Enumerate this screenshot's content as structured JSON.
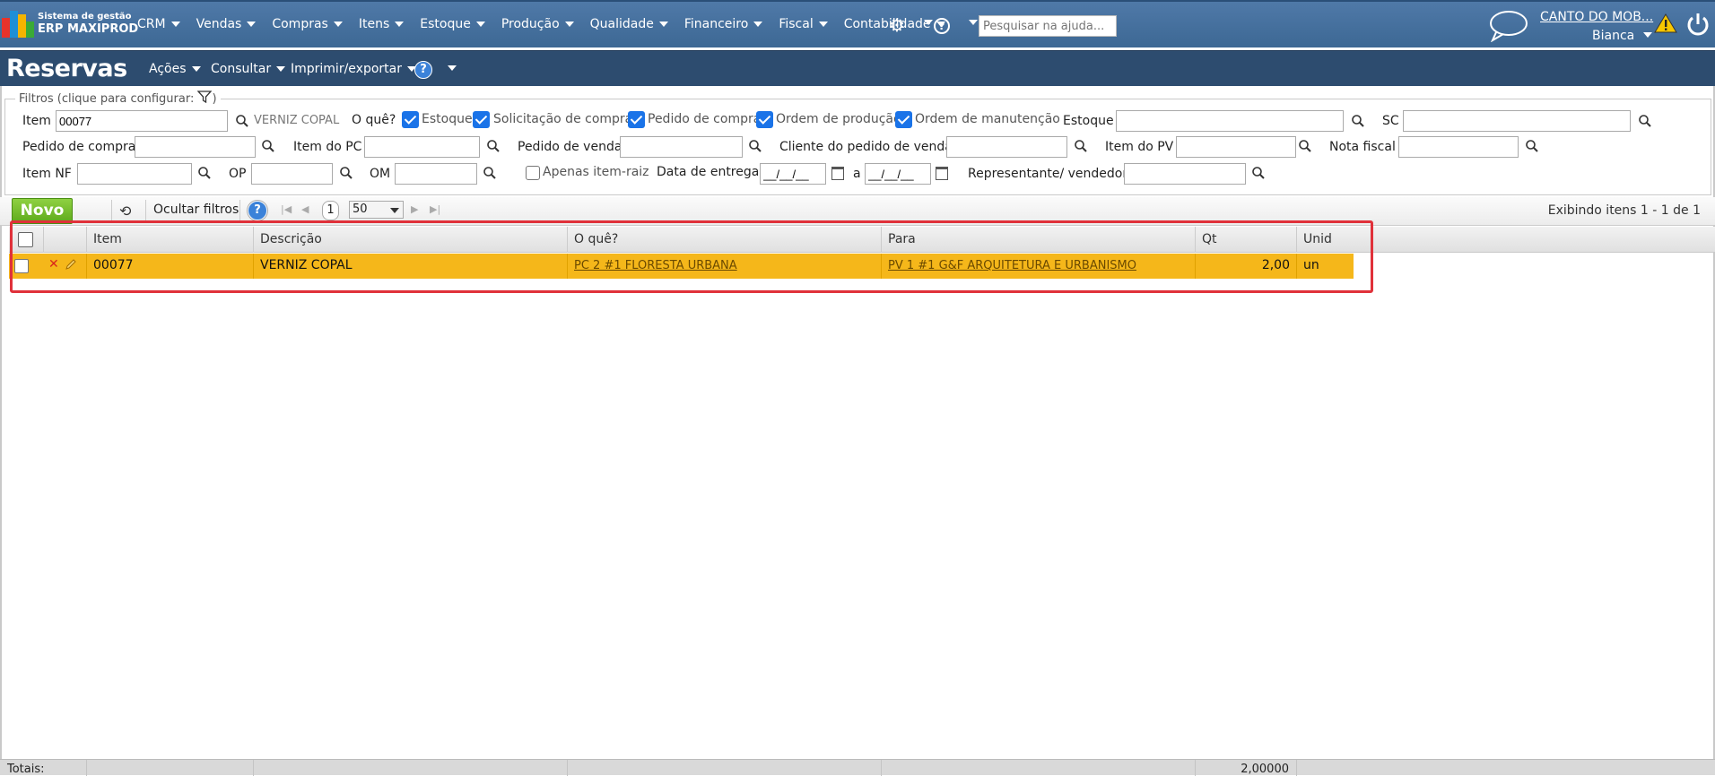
{
  "app": {
    "logo_line1": "Sistema de gestão",
    "logo_line2": "ERP MAXIPROD"
  },
  "nav": [
    "CRM",
    "Vendas",
    "Compras",
    "Itens",
    "Estoque",
    "Produção",
    "Qualidade",
    "Financeiro",
    "Fiscal",
    "Contabilidade"
  ],
  "help_search": {
    "placeholder": "Pesquisar na ajuda..."
  },
  "user": {
    "company": "CANTO DO MOB...",
    "name": "Bianca"
  },
  "page": {
    "title": "Reservas",
    "menus": [
      "Ações",
      "Consultar",
      "Imprimir/exportar"
    ]
  },
  "filters": {
    "legend": "Filtros (clique para configurar:",
    "legend_close": ")",
    "item_label": "Item",
    "item_value": "00077",
    "item_desc": "VERNIZ COPAL",
    "oque_label": "O quê?",
    "oque_options": [
      {
        "label": "Estoque",
        "checked": true
      },
      {
        "label": "Solicitação de compra",
        "checked": true
      },
      {
        "label": "Pedido de compra",
        "checked": true
      },
      {
        "label": "Ordem de produção",
        "checked": true
      },
      {
        "label": "Ordem de manutenção",
        "checked": true
      }
    ],
    "estoque_label": "Estoque",
    "sc_label": "SC",
    "pedido_compra_label": "Pedido de compra",
    "item_pc_label": "Item do PC",
    "pedido_venda_label": "Pedido de venda",
    "cliente_pv_label": "Cliente do pedido de venda",
    "item_pv_label": "Item do PV",
    "nota_fiscal_label": "Nota fiscal",
    "item_nf_label": "Item NF",
    "op_label": "OP",
    "om_label": "OM",
    "apenas_label": "Apenas item-raiz",
    "data_entrega_label": "Data de entrega",
    "date_from": "__/__/__",
    "date_sep": "a",
    "date_to": "__/__/__",
    "representante_label": "Representante/ vendedor"
  },
  "toolbar": {
    "novo": "Novo",
    "hide_filters": "Ocultar filtros",
    "page": "1",
    "page_size": "50",
    "showing": "Exibindo itens 1 - 1 de 1"
  },
  "grid": {
    "columns": [
      "Item",
      "Descrição",
      "O quê?",
      "Para",
      "Qt",
      "Unid"
    ],
    "rows": [
      {
        "item": "00077",
        "descricao": "VERNIZ COPAL",
        "oque": "PC 2 #1 FLORESTA URBANA",
        "para": "PV 1 #1 G&F ARQUITETURA E URBANISMO",
        "qt": "2,00",
        "unid": "un"
      }
    ],
    "totals_label": "Totais:",
    "totals_qt": "2,00000"
  },
  "colors": {
    "nav_bg": "#4a74a3",
    "title_bg": "#2d4c6f",
    "row_highlight": "#f5b71a",
    "novo_button": "#6cb826",
    "annotation_box": "#e0313a"
  }
}
